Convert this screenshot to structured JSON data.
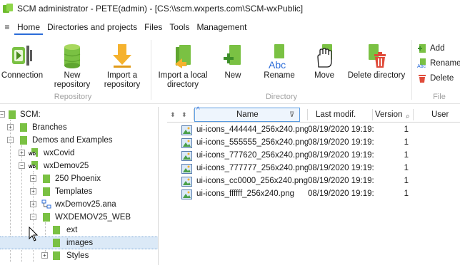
{
  "window": {
    "title": "SCM administrator - PETE(admin) - [CS:\\\\scm.wxperts.com\\SCM-wxPublic]"
  },
  "menu": {
    "hamburger": "≡",
    "tabs": [
      {
        "label": "Home",
        "active": true
      },
      {
        "label": "Directories and projects"
      },
      {
        "label": "Files"
      },
      {
        "label": "Tools"
      },
      {
        "label": "Management"
      }
    ]
  },
  "ribbon": {
    "groups": {
      "repository": "Repository",
      "directory": "Directory",
      "file": "File"
    },
    "buttons": {
      "connection": "Connection",
      "new_repository_1": "New",
      "new_repository_2": "repository",
      "import_repository_1": "Import a",
      "import_repository_2": "repository",
      "import_local_1": "Import a local",
      "import_local_2": "directory",
      "new": "New",
      "rename": "Rename",
      "rename_icon_text": "Abc",
      "move": "Move",
      "delete_directory": "Delete directory",
      "file_add": "Add",
      "file_rename": "Rename",
      "file_delete": "Delete"
    }
  },
  "tree": {
    "items": [
      {
        "label": "SCM:"
      },
      {
        "label": "Branches"
      },
      {
        "label": "Demos and Examples"
      },
      {
        "label": "wxCovid",
        "badge": "WD"
      },
      {
        "label": "wxDemov25",
        "badge": "WD"
      },
      {
        "label": "250 Phoenix"
      },
      {
        "label": "Templates"
      },
      {
        "label": "wxDemov25.ana"
      },
      {
        "label": "WXDEMOV25_WEB"
      },
      {
        "label": "ext"
      },
      {
        "label": "images"
      },
      {
        "label": "Styles"
      }
    ]
  },
  "list": {
    "columns": {
      "name": "Name",
      "last_modified": "Last modif.",
      "version": "Version",
      "user": "User"
    },
    "sort_indicator": "^",
    "filter_icon": "⊽",
    "rows": [
      {
        "name": "ui-icons_444444_256x240.png",
        "modified": "08/19/2020 19:19:",
        "version": "1"
      },
      {
        "name": "ui-icons_555555_256x240.png",
        "modified": "08/19/2020 19:19:",
        "version": "1"
      },
      {
        "name": "ui-icons_777620_256x240.png",
        "modified": "08/19/2020 19:19:",
        "version": "1"
      },
      {
        "name": "ui-icons_777777_256x240.png",
        "modified": "08/19/2020 19:19:",
        "version": "1"
      },
      {
        "name": "ui-icons_cc0000_256x240.png",
        "modified": "08/19/2020 19:19:",
        "version": "1"
      },
      {
        "name": "ui-icons_ffffff_256x240.png",
        "modified": "08/19/2020 19:19:",
        "version": "1"
      }
    ]
  },
  "colors": {
    "accent": "#2b6cd8",
    "folder_green": "#7ac143",
    "folder_green_light": "#a8d85e",
    "import_orange": "#f5b22e",
    "delete_red": "#e04b3a",
    "selection": "#dbe9f7"
  },
  "icons": {
    "connection": "plug-icon",
    "new_repository": "database-icon",
    "import_repository": "arrow-down-icon",
    "import_local": "folder-import-icon",
    "new": "folder-plus-icon",
    "rename": "rename-icon",
    "move": "hand-icon",
    "delete": "trash-icon"
  }
}
